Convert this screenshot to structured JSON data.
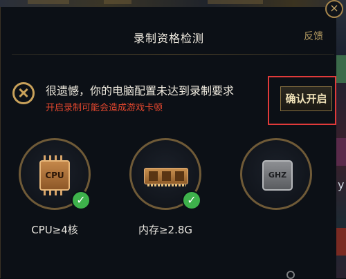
{
  "dialog": {
    "title": "录制资格检测",
    "feedback": "反馈",
    "close_glyph": "×"
  },
  "status": {
    "message": "很遗憾，你的电脑配置未达到录制要求",
    "warning": "开启录制可能会造成游戏卡顿"
  },
  "confirm": {
    "label": "确认开启"
  },
  "checks": [
    {
      "icon_text": "CPU",
      "label": "CPU≥4核",
      "passed": true,
      "icon": "cpu-chip-icon"
    },
    {
      "icon_text": "",
      "label": "内存≥2.8G",
      "passed": true,
      "icon": "memory-stick-icon"
    },
    {
      "icon_text": "GHZ",
      "label": "",
      "passed": false,
      "icon": "ghz-chip-icon"
    }
  ],
  "check_glyph": "✓",
  "background": {
    "right_char": "y"
  },
  "colors": {
    "accent_gold": "#c8a15a",
    "warning_red": "#e3472e",
    "highlight_border": "#e13a3a",
    "pass_green": "#3eb24b"
  }
}
